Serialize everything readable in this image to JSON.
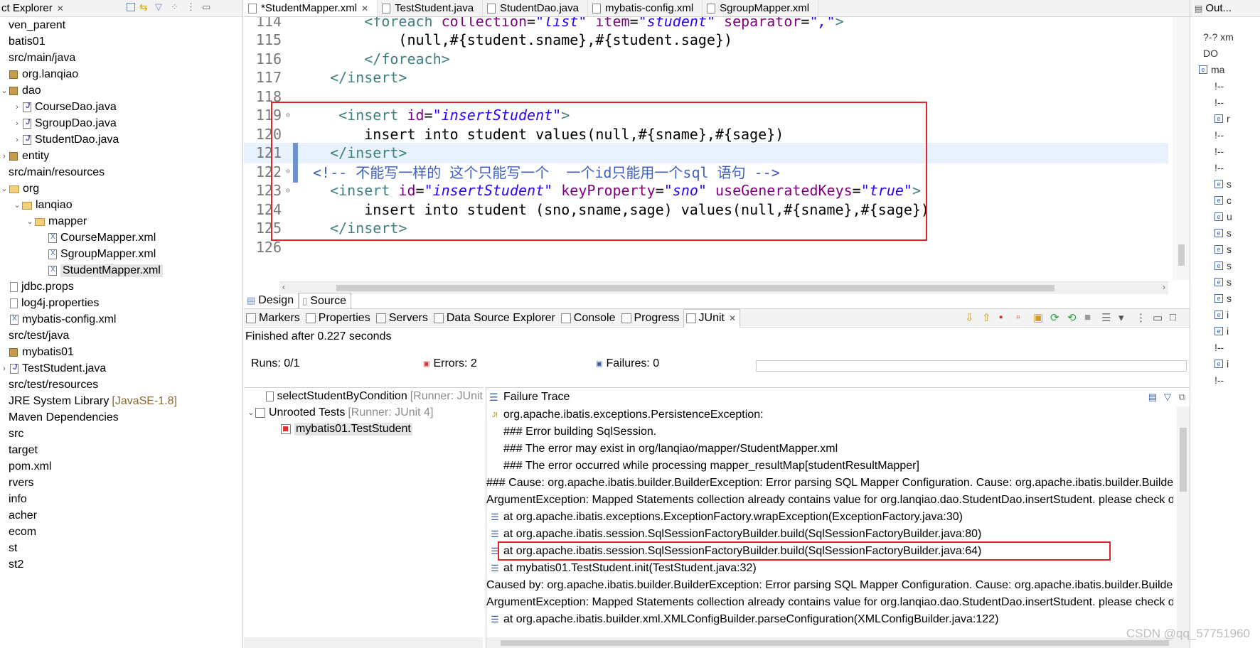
{
  "explorer": {
    "title": "ct Explorer",
    "items": [
      {
        "label": "ven_parent",
        "indent": 0,
        "twist": "",
        "icon": "none"
      },
      {
        "label": "batis01",
        "indent": 0,
        "twist": "",
        "icon": "none"
      },
      {
        "label": "src/main/java",
        "indent": 0,
        "twist": "",
        "icon": "none"
      },
      {
        "label": "org.lanqiao",
        "indent": 0,
        "twist": "",
        "icon": "pkg"
      },
      {
        "label": "dao",
        "indent": 0,
        "twist": "open",
        "icon": "pkg"
      },
      {
        "label": "CourseDao.java",
        "indent": 1,
        "twist": "closed",
        "icon": "java"
      },
      {
        "label": "SgroupDao.java",
        "indent": 1,
        "twist": "closed",
        "icon": "java"
      },
      {
        "label": "StudentDao.java",
        "indent": 1,
        "twist": "closed",
        "icon": "java"
      },
      {
        "label": "entity",
        "indent": 0,
        "twist": "closed",
        "icon": "pkg"
      },
      {
        "label": "src/main/resources",
        "indent": 0,
        "twist": "",
        "icon": "none"
      },
      {
        "label": "org",
        "indent": 0,
        "twist": "open",
        "icon": "folder"
      },
      {
        "label": "lanqiao",
        "indent": 1,
        "twist": "open",
        "icon": "folder"
      },
      {
        "label": "mapper",
        "indent": 2,
        "twist": "open",
        "icon": "folder"
      },
      {
        "label": "CourseMapper.xml",
        "indent": 3,
        "twist": "",
        "icon": "xml"
      },
      {
        "label": "SgroupMapper.xml",
        "indent": 3,
        "twist": "",
        "icon": "xml"
      },
      {
        "label": "StudentMapper.xml",
        "indent": 3,
        "twist": "",
        "icon": "xml",
        "selected": true
      },
      {
        "label": "jdbc.props",
        "indent": 0,
        "twist": "",
        "icon": "file"
      },
      {
        "label": "log4j.properties",
        "indent": 0,
        "twist": "",
        "icon": "file"
      },
      {
        "label": "mybatis-config.xml",
        "indent": 0,
        "twist": "",
        "icon": "xml"
      },
      {
        "label": "src/test/java",
        "indent": 0,
        "twist": "",
        "icon": "none"
      },
      {
        "label": "mybatis01",
        "indent": 0,
        "twist": "",
        "icon": "pkg"
      },
      {
        "label": "TestStudent.java",
        "indent": 0,
        "twist": "closed",
        "icon": "java"
      },
      {
        "label": "src/test/resources",
        "indent": 0,
        "twist": "",
        "icon": "none"
      },
      {
        "label": "JRE System Library",
        "suffix": "[JavaSE-1.8]",
        "indent": 0,
        "twist": "",
        "icon": "none"
      },
      {
        "label": "Maven Dependencies",
        "indent": 0,
        "twist": "",
        "icon": "none"
      },
      {
        "label": "src",
        "indent": 0,
        "twist": "",
        "icon": "none"
      },
      {
        "label": "target",
        "indent": 0,
        "twist": "",
        "icon": "none"
      },
      {
        "label": "pom.xml",
        "indent": 0,
        "twist": "",
        "icon": "none"
      },
      {
        "label": "rvers",
        "indent": 0,
        "twist": "",
        "icon": "none"
      },
      {
        "label": "info",
        "indent": 0,
        "twist": "",
        "icon": "none"
      },
      {
        "label": "acher",
        "indent": 0,
        "twist": "",
        "icon": "none"
      },
      {
        "label": "ecom",
        "indent": 0,
        "twist": "",
        "icon": "none"
      },
      {
        "label": "st",
        "indent": 0,
        "twist": "",
        "icon": "none"
      },
      {
        "label": "st2",
        "indent": 0,
        "twist": "",
        "icon": "none"
      }
    ]
  },
  "editor": {
    "tabs": [
      {
        "label": "*StudentMapper.xml",
        "active": true,
        "closable": true
      },
      {
        "label": "TestStudent.java",
        "active": false
      },
      {
        "label": "StudentDao.java",
        "active": false
      },
      {
        "label": "mybatis-config.xml",
        "active": false
      },
      {
        "label": "SgroupMapper.xml",
        "active": false
      }
    ],
    "lines": [
      {
        "num": "114",
        "fold": "",
        "indent": "      ",
        "tokens": [
          {
            "c": "t-tag",
            "t": "<foreach "
          },
          {
            "c": "t-attr",
            "t": "collection"
          },
          {
            "c": "t-txt",
            "t": "="
          },
          {
            "c": "t-str",
            "t": "\"list\""
          },
          {
            "c": "t-txt",
            "t": " "
          },
          {
            "c": "t-attr",
            "t": "item"
          },
          {
            "c": "t-txt",
            "t": "="
          },
          {
            "c": "t-str",
            "t": "\"student\""
          },
          {
            "c": "t-txt",
            "t": " "
          },
          {
            "c": "t-attr",
            "t": "separator"
          },
          {
            "c": "t-txt",
            "t": "="
          },
          {
            "c": "t-str",
            "t": "\",\""
          },
          {
            "c": "t-tag",
            "t": ">"
          }
        ]
      },
      {
        "num": "115",
        "fold": "",
        "indent": "          ",
        "tokens": [
          {
            "c": "t-txt",
            "t": "(null,#{student.sname},#{student.sage})"
          }
        ]
      },
      {
        "num": "116",
        "fold": "",
        "indent": "      ",
        "tokens": [
          {
            "c": "t-tag",
            "t": "</foreach>"
          }
        ]
      },
      {
        "num": "117",
        "fold": "",
        "indent": "  ",
        "tokens": [
          {
            "c": "t-tag",
            "t": "</insert>"
          }
        ]
      },
      {
        "num": "118",
        "fold": "",
        "indent": "",
        "tokens": []
      },
      {
        "num": "119",
        "fold": "⊖",
        "indent": "   ",
        "tokens": [
          {
            "c": "t-tag",
            "t": "<insert "
          },
          {
            "c": "t-attr",
            "t": "id"
          },
          {
            "c": "t-txt",
            "t": "="
          },
          {
            "c": "t-str",
            "t": "\"insertStudent\""
          },
          {
            "c": "t-tag",
            "t": ">"
          }
        ]
      },
      {
        "num": "120",
        "fold": "",
        "indent": "      ",
        "tokens": [
          {
            "c": "t-txt",
            "t": "insert into student values(null,#{sname},#{sage})"
          }
        ]
      },
      {
        "num": "121",
        "fold": "",
        "indent": "  ",
        "current": true,
        "tokens": [
          {
            "c": "t-tag",
            "t": "</insert>"
          }
        ]
      },
      {
        "num": "122",
        "fold": "⊖",
        "indent": "",
        "tokens": [
          {
            "c": "t-com",
            "t": "<!-- 不能写一样的 这个只能写一个  一个id只能用一个sql 语句 -->"
          }
        ]
      },
      {
        "num": "123",
        "fold": "⊖",
        "indent": "  ",
        "tokens": [
          {
            "c": "t-tag",
            "t": "<insert "
          },
          {
            "c": "t-attr",
            "t": "id"
          },
          {
            "c": "t-txt",
            "t": "="
          },
          {
            "c": "t-str",
            "t": "\"insertStudent\""
          },
          {
            "c": "t-txt",
            "t": " "
          },
          {
            "c": "t-attr",
            "t": "keyProperty"
          },
          {
            "c": "t-txt",
            "t": "="
          },
          {
            "c": "t-str",
            "t": "\"sno\""
          },
          {
            "c": "t-txt",
            "t": " "
          },
          {
            "c": "t-attr",
            "t": "useGeneratedKeys"
          },
          {
            "c": "t-txt",
            "t": "="
          },
          {
            "c": "t-str",
            "t": "\"true\""
          },
          {
            "c": "t-tag",
            "t": ">"
          }
        ]
      },
      {
        "num": "124",
        "fold": "",
        "indent": "      ",
        "tokens": [
          {
            "c": "t-txt",
            "t": "insert into student (sno,sname,sage) values(null,#{sname},#{sage})"
          }
        ]
      },
      {
        "num": "125",
        "fold": "",
        "indent": "  ",
        "tokens": [
          {
            "c": "t-tag",
            "t": "</insert>"
          }
        ]
      },
      {
        "num": "126",
        "fold": "",
        "indent": "",
        "tokens": []
      }
    ],
    "bottom_tabs": [
      "Design",
      "Source"
    ]
  },
  "bottom": {
    "view_tabs": [
      "Markers",
      "Properties",
      "Servers",
      "Data Source Explorer",
      "Console",
      "Progress",
      "JUnit"
    ],
    "active_tab": "JUnit",
    "finished": "Finished after 0.227 seconds",
    "runs_label": "Runs:",
    "runs_value": "0/1",
    "errors_label": "Errors:",
    "errors_value": "2",
    "failures_label": "Failures:",
    "failures_value": "0",
    "tests": [
      {
        "label": "selectStudentByCondition",
        "runner": "[Runner: JUnit",
        "indent": 1,
        "twist": ""
      },
      {
        "label": "Unrooted Tests",
        "runner": "[Runner: JUnit 4]",
        "indent": 0,
        "twist": "open"
      },
      {
        "label": "mybatis01.TestStudent",
        "runner": "",
        "indent": 2,
        "twist": "",
        "selected": true
      }
    ],
    "trace_title": "Failure Trace",
    "trace": [
      {
        "icon": "jx",
        "text": "org.apache.ibatis.exceptions.PersistenceException:"
      },
      {
        "icon": "",
        "text": "### Error building SqlSession."
      },
      {
        "icon": "",
        "text": "### The error may exist in org/lanqiao/mapper/StudentMapper.xml"
      },
      {
        "icon": "",
        "text": "### The error occurred while processing mapper_resultMap[studentResultMapper]"
      },
      {
        "icon": "",
        "text": "### Cause: org.apache.ibatis.builder.BuilderException: Error parsing SQL Mapper Configuration. Cause: org.apache.ibatis.builder.BuilderException: Error parsing SQL Mapper Configuration. Cause: java.lang.IllegalArgumentException"
      },
      {
        "icon": "",
        "text": "ArgumentException: Mapped Statements collection already contains value for org.lanqiao.dao.StudentDao.insertStudent. please check org/lanqiao/mapper/StudentMapper.xml"
      },
      {
        "icon": "lines",
        "text": "at org.apache.ibatis.exceptions.ExceptionFactory.wrapException(ExceptionFactory.java:30)"
      },
      {
        "icon": "lines",
        "text": "at org.apache.ibatis.session.SqlSessionFactoryBuilder.build(SqlSessionFactoryBuilder.java:80)"
      },
      {
        "icon": "lines",
        "text": "at org.apache.ibatis.session.SqlSessionFactoryBuilder.build(SqlSessionFactoryBuilder.java:64)"
      },
      {
        "icon": "lines",
        "text": "at mybatis01.TestStudent.init(TestStudent.java:32)"
      },
      {
        "icon": "",
        "text": "Caused by: org.apache.ibatis.builder.BuilderException: Error parsing SQL Mapper Configuration. Cause: org.apache.ibatis.builder.BuilderException: Error parsing SQL Mapper Configuration. Cause: java.lang.IllegalArgumentException"
      },
      {
        "icon": "",
        "text": "ArgumentException: Mapped Statements collection already contains value for org.lanqiao.dao.StudentDao.insertStudent. please check org/lanqiao/mapper/StudentMapper.xml"
      },
      {
        "icon": "lines",
        "text": "at org.apache.ibatis.builder.xml.XMLConfigBuilder.parseConfiguration(XMLConfigBuilder.java:122)"
      }
    ]
  },
  "outline": {
    "title": "Out...",
    "rows": [
      {
        "icon": "",
        "text": "?-? xm"
      },
      {
        "icon": "",
        "text": "DO"
      },
      {
        "icon": "e",
        "text": "ma"
      },
      {
        "icon": "",
        "text": "!--"
      },
      {
        "icon": "",
        "text": "!--"
      },
      {
        "icon": "e",
        "text": "r"
      },
      {
        "icon": "",
        "text": "!--"
      },
      {
        "icon": "",
        "text": "!--"
      },
      {
        "icon": "",
        "text": "!--"
      },
      {
        "icon": "e",
        "text": "s"
      },
      {
        "icon": "e",
        "text": "c"
      },
      {
        "icon": "e",
        "text": "u"
      },
      {
        "icon": "e",
        "text": "s"
      },
      {
        "icon": "e",
        "text": "s"
      },
      {
        "icon": "e",
        "text": "s"
      },
      {
        "icon": "e",
        "text": "s"
      },
      {
        "icon": "e",
        "text": "s"
      },
      {
        "icon": "e",
        "text": "i"
      },
      {
        "icon": "e",
        "text": "i"
      },
      {
        "icon": "",
        "text": "!--"
      },
      {
        "icon": "e",
        "text": "i"
      },
      {
        "icon": "",
        "text": "!--"
      }
    ]
  },
  "watermark": "CSDN @qq_57751960",
  "colors": {
    "highlight_box": "#e0242b",
    "tag": "#3f7f7f",
    "attr": "#7f007f",
    "string": "#2a00ff",
    "comment": "#3f5fbf"
  }
}
